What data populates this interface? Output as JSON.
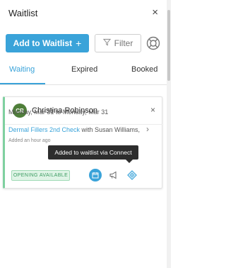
{
  "header": {
    "title": "Waitlist",
    "close_glyph": "×"
  },
  "toolbar": {
    "add_label": "Add to Waitlist",
    "add_plus": "+",
    "filter_label": "Filter",
    "help_icon": "lifebuoy-icon"
  },
  "tabs": [
    {
      "label": "Waiting",
      "active": true
    },
    {
      "label": "Expired",
      "active": false
    },
    {
      "label": "Booked",
      "active": false
    }
  ],
  "card": {
    "initials": "CR",
    "client_name": "Christina Robinson",
    "close_glyph": "×",
    "dates": "Monday, Mar 31 to Monday, Mar 31",
    "service": "Dermal Fillers 2nd Check",
    "with_text": " with Susan Williams,",
    "chevron": "›",
    "added": "Added an hour ago",
    "badge": "OPENING AVAILABLE",
    "tooltip": "Added to waitlist via Connect",
    "actions": [
      "calendar-icon",
      "megaphone-icon",
      "connect-icon"
    ]
  },
  "colors": {
    "accent": "#3aa3d9",
    "avatar": "#4f7f3a",
    "badge_bg": "#dff4e6",
    "badge_text": "#3c9c62",
    "card_stripe": "#7fd0a0"
  }
}
